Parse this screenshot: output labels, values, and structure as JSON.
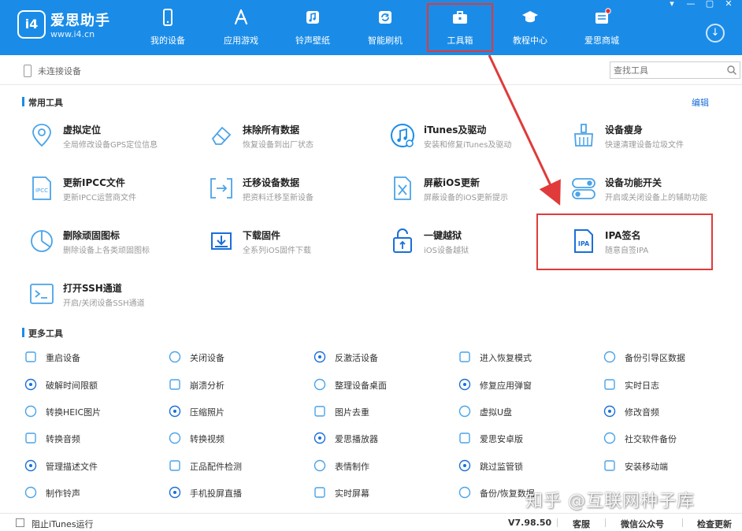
{
  "app": {
    "title": "爱思助手",
    "url": "www.i4.cn",
    "logo_text": "i4",
    "accent_color": "#1a8ce8"
  },
  "window_controls": {
    "dropdown": "▾",
    "minimize": "—",
    "restore": "▢",
    "close": "✕"
  },
  "nav": [
    {
      "label": "我的设备",
      "icon": "phone-icon"
    },
    {
      "label": "应用游戏",
      "icon": "app-store-icon"
    },
    {
      "label": "铃声壁纸",
      "icon": "music-icon"
    },
    {
      "label": "智能刷机",
      "icon": "flash-icon"
    },
    {
      "label": "工具箱",
      "icon": "toolbox-icon",
      "active": true
    },
    {
      "label": "教程中心",
      "icon": "graduation-cap-icon"
    },
    {
      "label": "爱思商城",
      "icon": "shop-icon",
      "badge": true
    }
  ],
  "device": {
    "status": "未连接设备"
  },
  "search": {
    "placeholder": "查找工具"
  },
  "common_section": {
    "title": "常用工具",
    "edit": "编辑"
  },
  "common_tools": [
    {
      "name": "虚拟定位",
      "desc": "全局修改设备GPS定位信息",
      "icon": "location-pin-icon"
    },
    {
      "name": "抹除所有数据",
      "desc": "恢复设备到出厂状态",
      "icon": "eraser-icon"
    },
    {
      "name": "iTunes及驱动",
      "desc": "安装和修复iTunes及驱动",
      "icon": "itunes-icon"
    },
    {
      "name": "设备瘦身",
      "desc": "快速清理设备垃圾文件",
      "icon": "broom-icon"
    },
    {
      "name": "更新IPCC文件",
      "desc": "更新IPCC运营商文件",
      "icon": "ipcc-file-icon"
    },
    {
      "name": "迁移设备数据",
      "desc": "把资料迁移至新设备",
      "icon": "migrate-icon"
    },
    {
      "name": "屏蔽iOS更新",
      "desc": "屏蔽设备的iOS更新提示",
      "icon": "block-update-icon"
    },
    {
      "name": "设备功能开关",
      "desc": "开启或关闭设备上的辅助功能",
      "icon": "toggle-icon"
    },
    {
      "name": "删除顽固图标",
      "desc": "删除设备上各类顽固图标",
      "icon": "pie-clock-icon"
    },
    {
      "name": "下载固件",
      "desc": "全系列iOS固件下载",
      "icon": "download-tray-icon"
    },
    {
      "name": "一键越狱",
      "desc": "iOS设备越狱",
      "icon": "unlock-icon"
    },
    {
      "name": "IPA签名",
      "desc": "随意自签IPA",
      "icon": "ipa-file-icon"
    },
    {
      "name": "打开SSH通道",
      "desc": "开启/关闭设备SSH通道",
      "icon": "terminal-icon"
    }
  ],
  "more_section": {
    "title": "更多工具"
  },
  "more_tools": [
    {
      "name": "重启设备",
      "icon": "spinner-icon"
    },
    {
      "name": "关闭设备",
      "icon": "power-icon"
    },
    {
      "name": "反激活设备",
      "icon": "deactivate-icon"
    },
    {
      "name": "进入恢复模式",
      "icon": "recovery-icon"
    },
    {
      "name": "备份引导区数据",
      "icon": "backup-boot-icon"
    },
    {
      "name": "破解时间限额",
      "icon": "hourglass-icon"
    },
    {
      "name": "崩溃分析",
      "icon": "crash-grid-icon"
    },
    {
      "name": "整理设备桌面",
      "icon": "desktop-grid-icon"
    },
    {
      "name": "修复应用弹窗",
      "icon": "repair-icon"
    },
    {
      "name": "实时日志",
      "icon": "log-icon"
    },
    {
      "name": "转换HEIC图片",
      "icon": "heic-image-icon"
    },
    {
      "name": "压缩照片",
      "icon": "compress-image-icon"
    },
    {
      "name": "图片去重",
      "icon": "dedupe-image-icon"
    },
    {
      "name": "虚拟U盘",
      "icon": "usb-icon"
    },
    {
      "name": "修改音频",
      "icon": "audio-edit-icon"
    },
    {
      "name": "转换音频",
      "icon": "waveform-icon"
    },
    {
      "name": "转换视频",
      "icon": "video-convert-icon"
    },
    {
      "name": "爱思播放器",
      "icon": "player-icon"
    },
    {
      "name": "爱思安卓版",
      "icon": "android-icon"
    },
    {
      "name": "社交软件备份",
      "icon": "social-backup-icon"
    },
    {
      "name": "管理描述文件",
      "icon": "profile-icon"
    },
    {
      "name": "正品配件检测",
      "icon": "accessory-check-icon"
    },
    {
      "name": "表情制作",
      "icon": "smiley-icon"
    },
    {
      "name": "跳过监管锁",
      "icon": "skip-lock-icon"
    },
    {
      "name": "安装移动端",
      "icon": "install-mobile-icon"
    },
    {
      "name": "制作铃声",
      "icon": "ringtone-icon"
    },
    {
      "name": "手机投屏直播",
      "icon": "cast-icon"
    },
    {
      "name": "实时屏幕",
      "icon": "screen-icon"
    },
    {
      "name": "备份/恢复数据",
      "icon": "umbrella-icon"
    },
    {
      "name": "",
      "icon": "blank-icon"
    }
  ],
  "watermark": "知乎 @互联网种子库",
  "footer": {
    "itunes_block": "阻止iTunes运行",
    "version": "V7.98.50",
    "support": "客服",
    "wechat": "微信公众号",
    "update": "检查更新"
  }
}
